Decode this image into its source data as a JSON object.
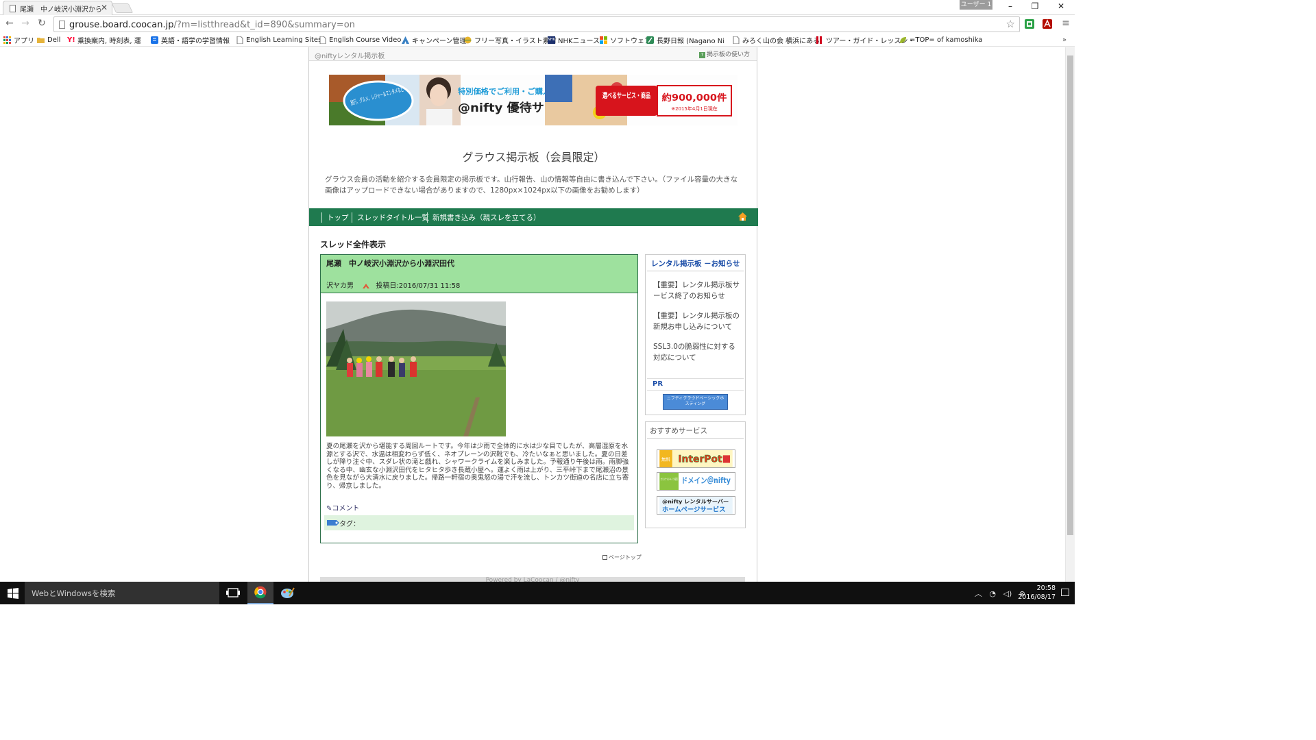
{
  "browser": {
    "tab_title": "尾瀬　中ノ岐沢小淵沢から",
    "user_label": "ユーザー 1",
    "url_host": "grouse.board.coocan.jp",
    "url_path": "/?m=listthread&t_id=890&summary=on"
  },
  "bookmarks": [
    {
      "label": "アプリ",
      "icon": "apps-grid-icon",
      "color": "#e8453c"
    },
    {
      "label": "Dell",
      "icon": "folder-icon",
      "color": "#e6b43c"
    },
    {
      "label": "乗換案内, 時刻表, 運",
      "icon": "yahoo-icon",
      "color": "#ff0033"
    },
    {
      "label": "英語・語学の学習情報",
      "icon": "bookmark-icon",
      "color": "#1a73e8"
    },
    {
      "label": "English Learning Sites",
      "icon": "page-icon",
      "color": "#777777"
    },
    {
      "label": "English Course Video",
      "icon": "page-icon",
      "color": "#777777"
    },
    {
      "label": "キャンペーン管理",
      "icon": "adwords-icon",
      "color": "#3b82c4"
    },
    {
      "label": "フリー写真・イラスト素材",
      "icon": "globe-icon",
      "color": "#e8b52c"
    },
    {
      "label": "NHKニュース",
      "icon": "nhk-icon",
      "color": "#1b2f6b"
    },
    {
      "label": "ソフトウェア",
      "icon": "windows-icon",
      "color": "#f25022"
    },
    {
      "label": "長野日報 (Nagano Ni",
      "icon": "feather-icon",
      "color": "#2e8b57"
    },
    {
      "label": "みろく山の会 横浜にある",
      "icon": "page-icon",
      "color": "#777777"
    },
    {
      "label": "ツアー・ガイド・レッスン・",
      "icon": "bars-icon",
      "color": "#d0021b"
    },
    {
      "label": "=TOP= of kamoshika",
      "icon": "leaf-icon",
      "color": "#9ab52a"
    }
  ],
  "board": {
    "top_label": "@niftyレンタル掲示板",
    "howto_label": "掲示板の使い方",
    "banner": {
      "pill_text": "旅行、グルメ、レジャー＆エンタメなど",
      "tagline": "特別価格でご利用・ご購入できる！",
      "service_name": "@nifty 優待サービス",
      "box_label": "選べるサービス・商品",
      "count": "約900,000件",
      "date_note": "※2015年4月1日現在"
    },
    "title": "グラウス掲示板（会員限定）",
    "description": "グラウス会員の活動を紹介する会員限定の掲示板です。山行報告、山の情報等自由に書き込んで下さい。（ファイル容量の大きな画像はアップロードできない場合がありますので、1280px×1024px以下の画像をお勧めします）",
    "nav": [
      "トップ",
      "スレッドタイトル一覧",
      "新規書き込み（親スレを立てる）"
    ],
    "section_title": "スレッド全件表示",
    "post": {
      "title": "尾瀬　中ノ岐沢小淵沢から小淵沢田代",
      "author": "沢ヤカ男",
      "date": "投稿日:2016/07/31 11:58",
      "body": "夏の尾瀬を沢から堪能する周回ルートです。今年は少雨で全体的に水は少な目でしたが、高層湿原を水源とする沢で、水温は相変わらず低く、ネオプレーンの沢靴でも、冷たいなぁと思いました。夏の日差しが降り注ぐ中、スダレ状の滝と戯れ、シャワークライムを楽しみました。予報通り午後は雨。雨脚強くなる中、幽玄な小淵沢田代をヒタヒタ歩き長蔵小屋へ。運よく雨は上がり、三平峠下まで尾瀬沼の景色を見ながら大清水に戻りました。帰路一軒宿の奥鬼怒の湯で汗を流し、トンカツ街道の名店に立ち寄り、帰京しました。",
      "comment_label": "コメント",
      "tag_label": "タグ："
    },
    "pagetop_label": "ページトップ",
    "footer_text": "Powered by LaCoocan / @nifty"
  },
  "sidebar": {
    "notice_title": "レンタル掲示板 －お知らせ",
    "notices": [
      "【重要】レンタル掲示板サービス終了のお知らせ",
      "【重要】レンタル掲示板の新規お申し込みについて",
      "SSL3.0の脆弱性に対する対応について"
    ],
    "pr_title": "PR",
    "pr_banner_text": "ニフティクラウドベーシックホスティング",
    "recommend_title": "おすすめサービス",
    "recommend_banners": [
      {
        "text": "InterPot",
        "note": "無料"
      },
      {
        "text": "ドメイン＠nifty",
        "note": "オリジナルドメイン取得"
      },
      {
        "text": "ホームページサービス",
        "note": "@nifty レンタルサーバー"
      }
    ]
  },
  "taskbar": {
    "search_placeholder": "WebとWindowsを検索",
    "time": "20:58",
    "date": "2016/08/17"
  },
  "colors": {
    "board_nav": "#1f7a4f",
    "post_header": "#9ee19e",
    "link_blue": "#1c4ea8",
    "taskbar": "#101010"
  }
}
